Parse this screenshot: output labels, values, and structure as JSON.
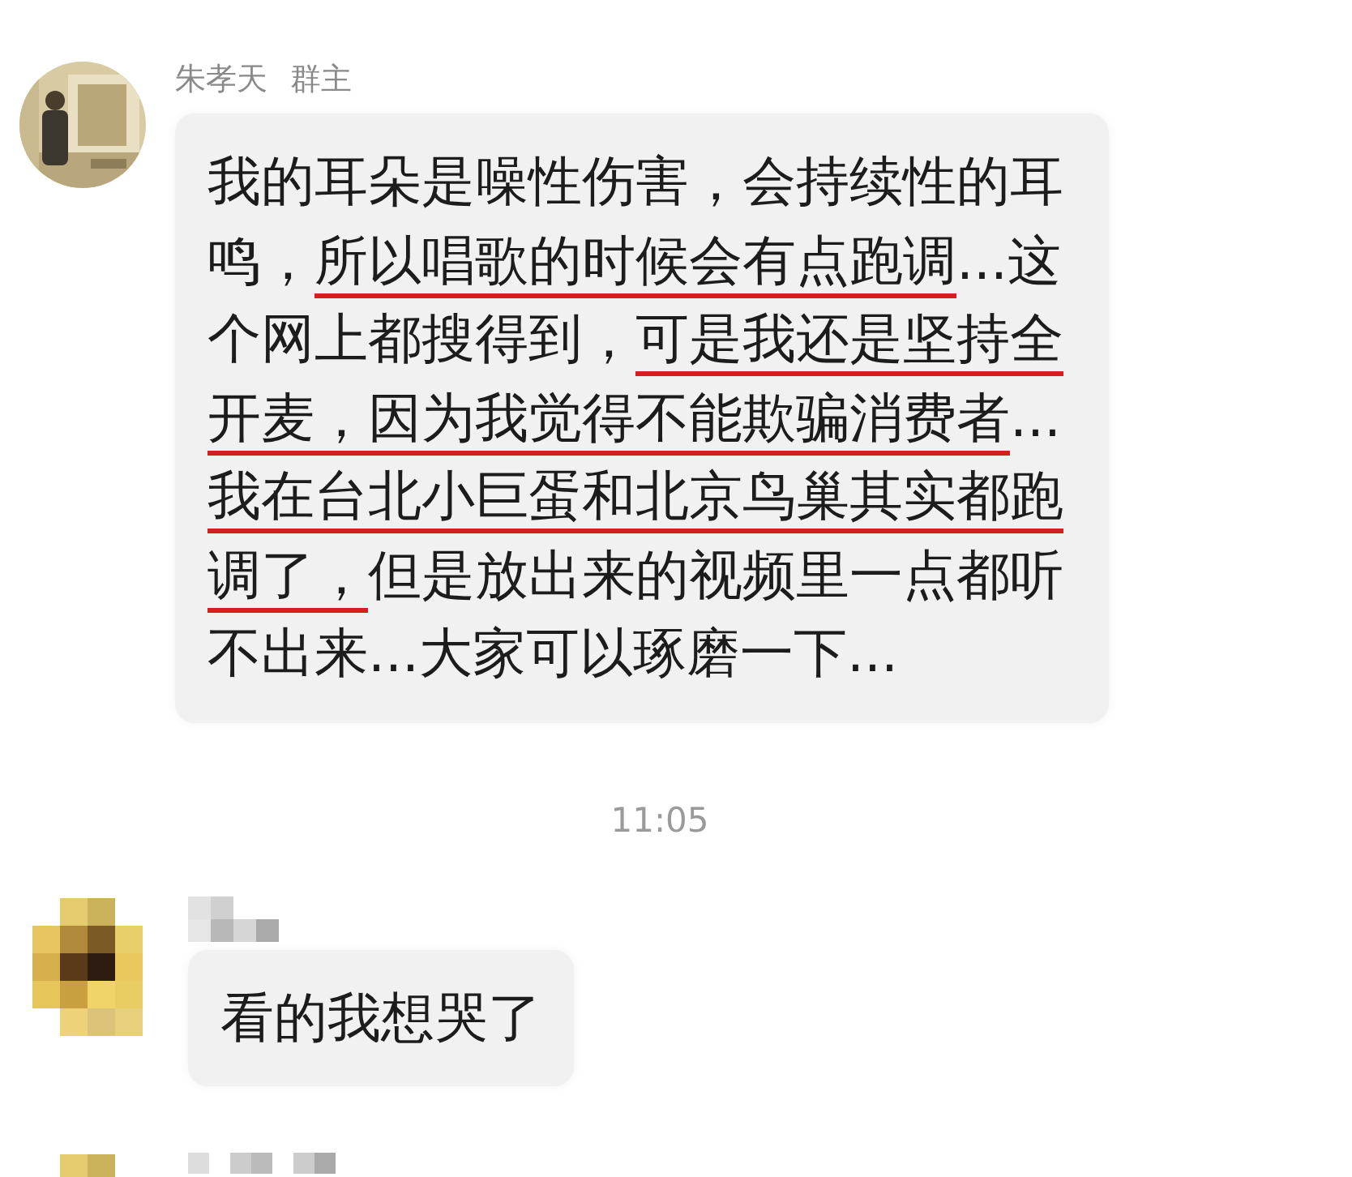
{
  "messages": [
    {
      "sender": "朱孝天",
      "badge": "群主",
      "segments": [
        {
          "text": "我的耳朵是噪性伤害，会持续性的耳鸣，",
          "underlined": false
        },
        {
          "text": "所以唱歌的时候会有点跑调",
          "underlined": true
        },
        {
          "text": "...这个网上都搜得到，",
          "underlined": false
        },
        {
          "text": "可是我还是坚持全开麦，因为我觉得不能欺骗消费者",
          "underlined": true
        },
        {
          "text": "...",
          "underlined": false
        },
        {
          "text": "我在台北小巨蛋和北京鸟巢其实都跑调了，",
          "underlined": true
        },
        {
          "text": "但是放出来的视频里一点都听不出来...大家可以琢磨一下...",
          "underlined": false
        }
      ]
    },
    {
      "kind": "timestamp",
      "text": "11:05"
    },
    {
      "kind": "pixelated",
      "segments": [
        {
          "text": "看的我想哭了",
          "underlined": false
        }
      ]
    },
    {
      "kind": "pixelated"
    }
  ]
}
